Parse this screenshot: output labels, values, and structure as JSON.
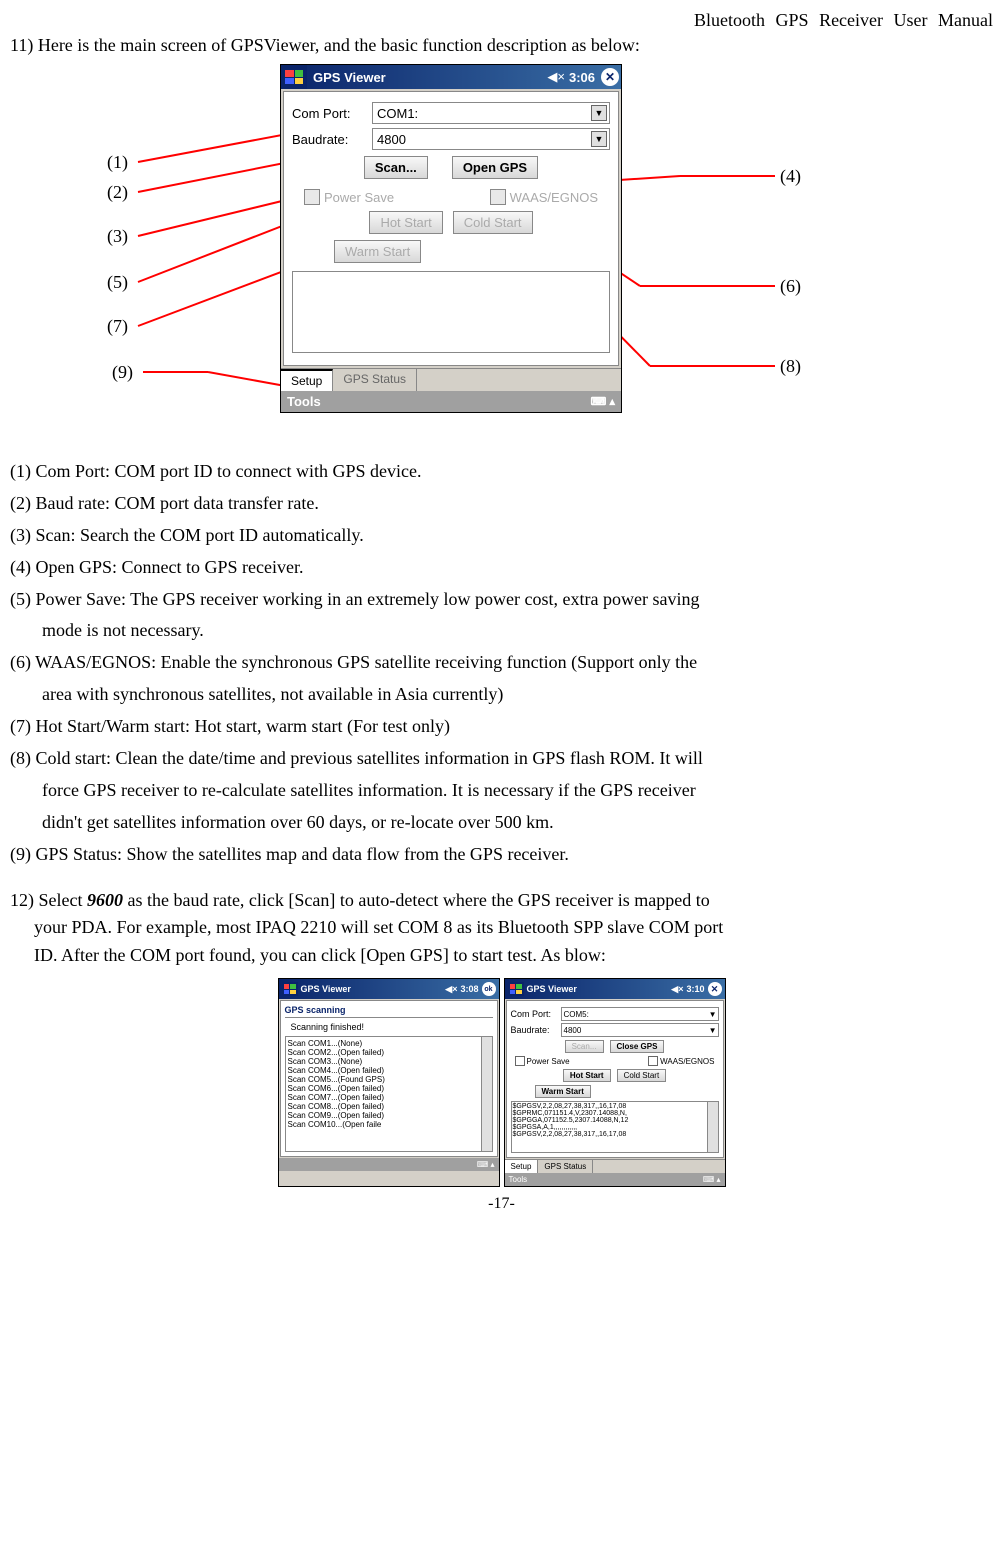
{
  "header": "Bluetooth  GPS  Receiver  User  Manual",
  "intro": "11) Here is the main screen of GPSViewer, and the basic function description as below:",
  "callouts": {
    "c1": "(1)",
    "c2": "(2)",
    "c3": "(3)",
    "c4": "(4)",
    "c5": "(5)",
    "c6": "(6)",
    "c7": "(7)",
    "c8": "(8)",
    "c9": "(9)"
  },
  "app": {
    "title": "GPS Viewer",
    "time": "3:06",
    "comport_label": "Com Port:",
    "comport_value": "COM1:",
    "baud_label": "Baudrate:",
    "baud_value": "4800",
    "scan": "Scan...",
    "open_gps": "Open GPS",
    "power_save": "Power Save",
    "waas": "WAAS/EGNOS",
    "hot_start": "Hot Start",
    "cold_start": "Cold Start",
    "warm_start": "Warm Start",
    "tab_setup": "Setup",
    "tab_status": "GPS Status",
    "tools": "Tools"
  },
  "desc": {
    "d1": "(1) Com Port: COM port ID to connect with GPS device.",
    "d2": "(2) Baud rate: COM port data transfer rate.",
    "d3": "(3) Scan: Search the COM port ID automatically.",
    "d4": "(4) Open GPS: Connect to GPS receiver.",
    "d5a": "(5) Power Save: The GPS receiver working in an extremely low power cost, extra power saving",
    "d5b": "mode is not necessary.",
    "d6a": "(6) WAAS/EGNOS: Enable the synchronous GPS satellite receiving function (Support only the",
    "d6b": "area with synchronous satellites, not available in Asia currently)",
    "d7": "(7) Hot Start/Warm start: Hot start, warm start (For test only)",
    "d8a": "(8) Cold start: Clean the date/time and previous satellites information in GPS flash ROM. It will",
    "d8b": "force GPS receiver to re-calculate satellites information. It is necessary if the GPS receiver",
    "d8c": "didn't get satellites information over 60 days, or re-locate over 500 km.",
    "d9": "(9) GPS Status: Show the satellites map and data flow from the GPS receiver."
  },
  "step12": {
    "prefix": "12) Select ",
    "bold": "9600",
    "rest1": " as the baud rate, click [Scan] to auto-detect where the GPS receiver is mapped to",
    "line2": "your PDA. For example, most IPAQ 2210 will set COM 8 as its Bluetooth SPP slave COM port",
    "line3": "ID. After the COM port found, you can click [Open GPS] to start test. As blow:"
  },
  "mini1": {
    "title": "GPS Viewer",
    "time": "3:08",
    "ok": "ok",
    "heading": "GPS scanning",
    "finished": "Scanning finished!",
    "rows": [
      "Scan COM1...(None)",
      "Scan COM2...(Open failed)",
      "Scan COM3...(None)",
      "Scan COM4...(Open failed)",
      "Scan COM5...(Found GPS)",
      "Scan COM6...(Open failed)",
      "Scan COM7...(Open failed)",
      "Scan COM8...(Open failed)",
      "Scan COM9...(Open failed)",
      "Scan COM10...(Open faile"
    ]
  },
  "mini2": {
    "title": "GPS Viewer",
    "time": "3:10",
    "comport_label": "Com Port:",
    "comport_value": "COM5:",
    "baud_label": "Baudrate:",
    "baud_value": "4800",
    "scan": "Scan...",
    "close_gps": "Close GPS",
    "power_save": "Power Save",
    "waas": "WAAS/EGNOS",
    "hot_start": "Hot Start",
    "cold_start": "Cold Start",
    "warm_start": "Warm Start",
    "nmea": [
      "$GPGSV,2,2,08,27,38,317,,16,17,08",
      "$GPRMC,071151.4,V,2307.14088,N,",
      "$GPGGA,071152.5,2307.14088,N,12",
      "$GPGSA,A,1,,,,,,,,,,,,",
      "$GPGSV,2,2,08,27,38,317,,16,17,08"
    ],
    "tab_setup": "Setup",
    "tab_status": "GPS Status",
    "tools": "Tools"
  },
  "footer": "-17-"
}
